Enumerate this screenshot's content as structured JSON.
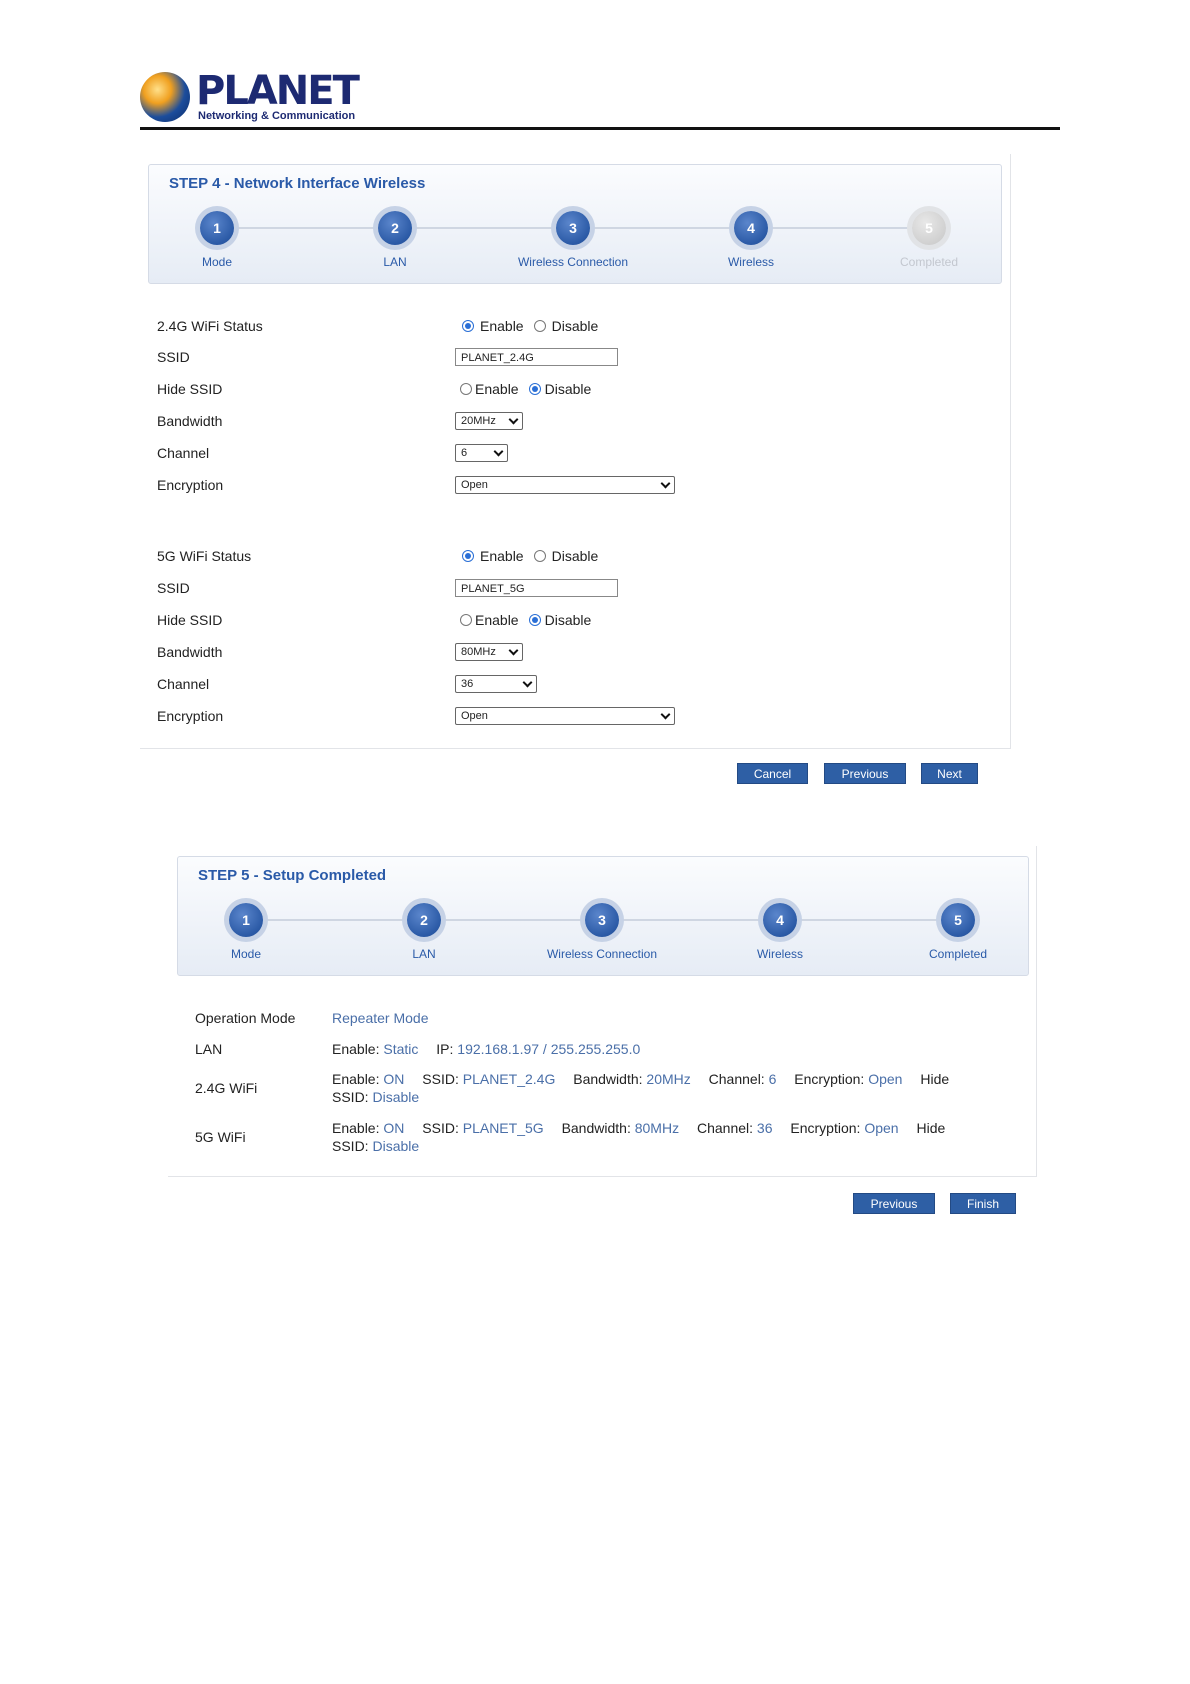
{
  "header": {
    "brand": "PLANET",
    "tagline": "Networking & Communication"
  },
  "step4": {
    "title": "STEP 4 - Network Interface Wireless",
    "steps": [
      {
        "num": "1",
        "label": "Mode"
      },
      {
        "num": "2",
        "label": "LAN"
      },
      {
        "num": "3",
        "label": "Wireless Connection"
      },
      {
        "num": "4",
        "label": "Wireless"
      },
      {
        "num": "5",
        "label": "Completed"
      }
    ],
    "wifi24": {
      "status_label": "2.4G WiFi Status",
      "ssid_label": "SSID",
      "ssid_value": "PLANET_2.4G",
      "hide_label": "Hide SSID",
      "bandwidth_label": "Bandwidth",
      "bandwidth_value": "20MHz",
      "channel_label": "Channel",
      "channel_value": "6",
      "encryption_label": "Encryption",
      "encryption_value": "Open"
    },
    "wifi5": {
      "status_label": "5G WiFi Status",
      "ssid_label": "SSID",
      "ssid_value": "PLANET_5G",
      "hide_label": "Hide SSID",
      "bandwidth_label": "Bandwidth",
      "bandwidth_value": "80MHz",
      "channel_label": "Channel",
      "channel_value": "36",
      "encryption_label": "Encryption",
      "encryption_value": "Open"
    },
    "radio_enable": "Enable",
    "radio_disable": "Disable",
    "buttons": {
      "cancel": "Cancel",
      "previous": "Previous",
      "next": "Next"
    }
  },
  "step5": {
    "title": "STEP 5 - Setup Completed",
    "steps": [
      {
        "num": "1",
        "label": "Mode"
      },
      {
        "num": "2",
        "label": "LAN"
      },
      {
        "num": "3",
        "label": "Wireless Connection"
      },
      {
        "num": "4",
        "label": "Wireless"
      },
      {
        "num": "5",
        "label": "Completed"
      }
    ],
    "op_mode_label": "Operation Mode",
    "op_mode_value": "Repeater Mode",
    "lan_label": "LAN",
    "lan": {
      "enable_k": "Enable:",
      "enable_v": "Static",
      "ip_k": "IP:",
      "ip_v": "192.168.1.97 / 255.255.255.0"
    },
    "wifi24_label": "2.4G WiFi",
    "wifi24": {
      "enable_k": "Enable:",
      "enable_v": "ON",
      "ssid_k": "SSID:",
      "ssid_v": "PLANET_2.4G",
      "bw_k": "Bandwidth:",
      "bw_v": "20MHz",
      "ch_k": "Channel:",
      "ch_v": "6",
      "enc_k": "Encryption:",
      "enc_v": "Open",
      "hide_k1": "Hide",
      "hide_k2": "SSID:",
      "hide_v": "Disable"
    },
    "wifi5_label": "5G WiFi",
    "wifi5": {
      "enable_k": "Enable:",
      "enable_v": "ON",
      "ssid_k": "SSID:",
      "ssid_v": "PLANET_5G",
      "bw_k": "Bandwidth:",
      "bw_v": "80MHz",
      "ch_k": "Channel:",
      "ch_v": "36",
      "enc_k": "Encryption:",
      "enc_v": "Open",
      "hide_k1": "Hide",
      "hide_k2": "SSID:",
      "hide_v": "Disable"
    },
    "buttons": {
      "previous": "Previous",
      "finish": "Finish"
    }
  },
  "colors": {
    "accent": "#2a5aa8",
    "button": "#2e5fa5",
    "value_text": "#4a6fa8"
  }
}
